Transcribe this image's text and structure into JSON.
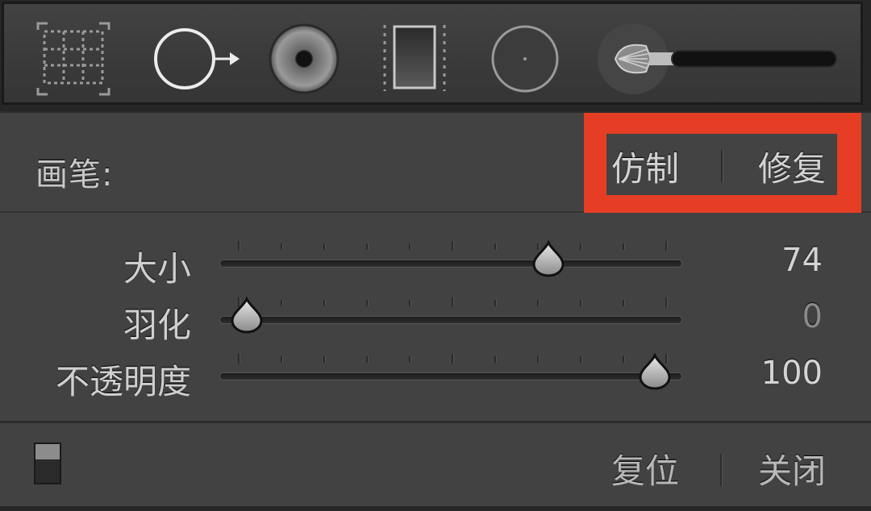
{
  "toolbar": {
    "tools": [
      {
        "name": "crop-overlay-icon"
      },
      {
        "name": "spot-removal-icon"
      },
      {
        "name": "red-eye-correction-icon"
      },
      {
        "name": "graduated-filter-icon"
      },
      {
        "name": "radial-filter-icon"
      },
      {
        "name": "adjustment-brush-icon"
      }
    ]
  },
  "brush": {
    "label": "画笔:",
    "modes": {
      "clone": "仿制",
      "heal": "修复"
    },
    "highlight_color": "#e53e25"
  },
  "sliders": [
    {
      "label": "大小",
      "value": "74",
      "position": 0.72
    },
    {
      "label": "羽化",
      "value": "0",
      "position": 0.04
    },
    {
      "label": "不透明度",
      "value": "100",
      "position": 0.96
    }
  ],
  "footer": {
    "reset": "复位",
    "close": "关闭"
  }
}
